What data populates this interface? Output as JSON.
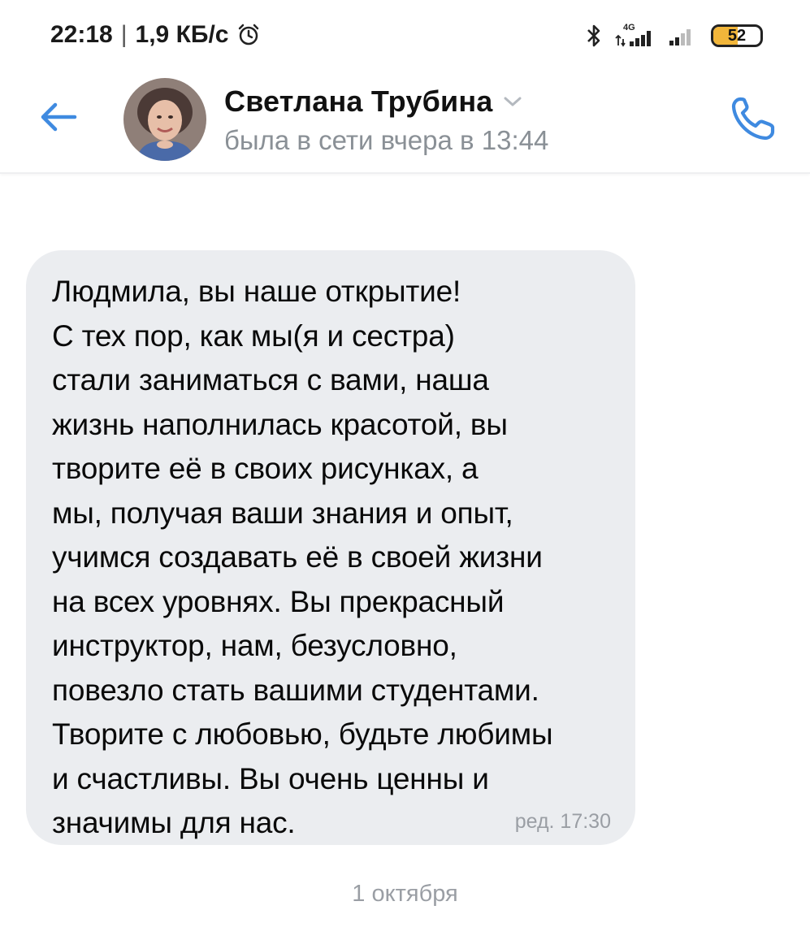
{
  "status_bar": {
    "time": "22:18",
    "separator": "|",
    "net_speed": "1,9 КБ/с",
    "signal_label": "4G",
    "battery": "52",
    "battery_level": 0.52,
    "battery_color": "#f2b63a",
    "icons": [
      "alarm-icon",
      "bluetooth-icon",
      "signal-4g-icon",
      "signal-icon",
      "battery-icon"
    ]
  },
  "header": {
    "name": "Светлана Трубина",
    "status": "была в сети вчера в 13:44",
    "icons": [
      "back-arrow-icon",
      "chevron-down-icon",
      "phone-icon"
    ],
    "accent_color": "#3f8ae0"
  },
  "message": {
    "text": "Людмила, вы наше открытие!\nС тех пор, как мы(я и сестра)\nстали заниматься с вами, наша\nжизнь наполнилась красотой, вы\nтворите её в своих рисунках, а\nмы, получая ваши знания и опыт,\nучимся создавать её в своей жизни\nна всех уровнях. Вы прекрасный\nинструктор, нам, безусловно,\nповезло стать вашими студентами.\nТворите с любовью, будьте любимы\nи счастливы. Вы очень ценны и\nзначимы для нас.",
    "meta": "ред. 17:30",
    "bubble_color": "#ebedf0"
  },
  "date_separator": "1 октября"
}
